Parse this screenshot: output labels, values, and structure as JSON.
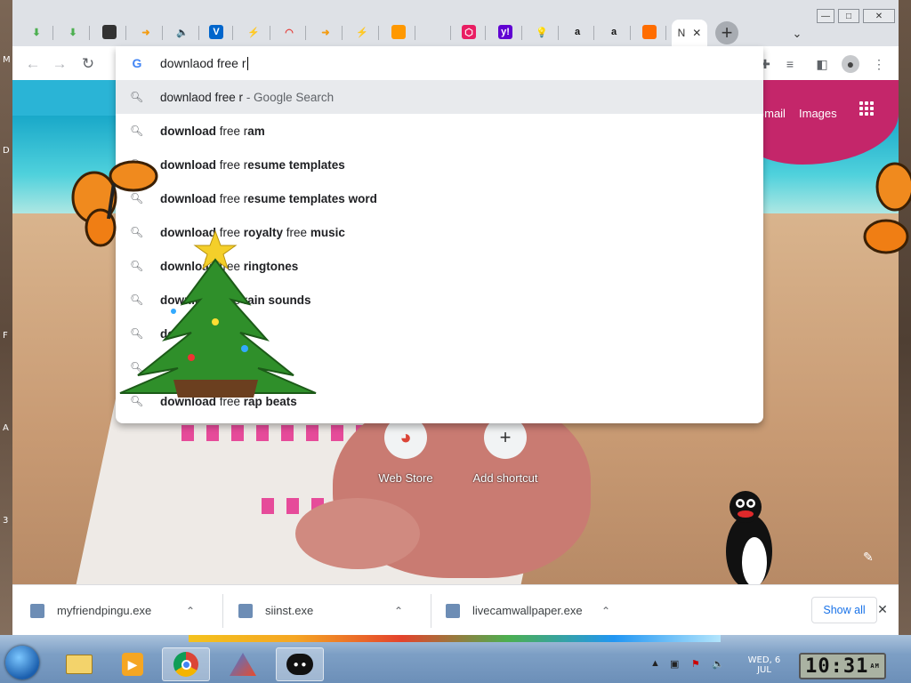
{
  "desktop": {
    "side_letters": [
      "M",
      "D",
      "F",
      "A",
      "3"
    ]
  },
  "tabs": [
    {
      "icon": "download-icon",
      "color": "#4caf50",
      "glyph": "⬇"
    },
    {
      "icon": "download-icon",
      "color": "#4caf50",
      "glyph": "⬇"
    },
    {
      "icon": "keyboard-icon",
      "color": "#333333",
      "glyph": "⌨"
    },
    {
      "icon": "arrow-icon",
      "color": "#f39c12",
      "glyph": "➜"
    },
    {
      "icon": "speaker-icon",
      "color": "#555555",
      "glyph": "🔈"
    },
    {
      "icon": "v-icon",
      "color": "#0066cc",
      "glyph": "V"
    },
    {
      "icon": "lightning-icon",
      "color": "#1e88e5",
      "glyph": "⚡"
    },
    {
      "icon": "arc-icon",
      "color": "#e53935",
      "glyph": "◠"
    },
    {
      "icon": "arrow-icon",
      "color": "#f39c12",
      "glyph": "➜"
    },
    {
      "icon": "lightning-icon",
      "color": "#1e88e5",
      "glyph": "⚡"
    },
    {
      "icon": "orange-circle-icon",
      "color": "#ff9800",
      "glyph": "●"
    },
    {
      "icon": "blank-icon",
      "color": "#dee1e6",
      "glyph": ""
    },
    {
      "icon": "shield-icon",
      "color": "#e91e63",
      "glyph": "⬡"
    },
    {
      "icon": "yahoo-icon",
      "color": "#6001d2",
      "glyph": "y!"
    },
    {
      "icon": "bulb-icon",
      "color": "#ffc107",
      "glyph": "💡"
    },
    {
      "icon": "amazon-icon",
      "color": "#111111",
      "glyph": "a"
    },
    {
      "icon": "amazon-icon",
      "color": "#111111",
      "glyph": "a"
    },
    {
      "icon": "firefox-icon",
      "color": "#ff6d00",
      "glyph": "●"
    }
  ],
  "active_tab": {
    "label": "N",
    "close": "✕"
  },
  "new_tab": {
    "glyph": "+"
  },
  "window_controls": {
    "minimize": "—",
    "maximize": "□",
    "close": "✕"
  },
  "omnibox": {
    "text": "downlaod free r",
    "suggestions": [
      {
        "bold_a": "",
        "plain": "downlaod free r",
        "bold_b": "",
        "suffix": " - Google Search"
      },
      {
        "bold_a": "download",
        "plain": " free r",
        "bold_b": "am",
        "suffix": ""
      },
      {
        "bold_a": "download",
        "plain": " free r",
        "bold_b": "esume templates",
        "suffix": ""
      },
      {
        "bold_a": "download",
        "plain": " free r",
        "bold_b": "esume templates word",
        "suffix": ""
      },
      {
        "bold_a": "download",
        "plain": " free ",
        "bold_b": "royalty",
        "plain2": " free ",
        "bold_c": "music"
      },
      {
        "bold_a": "download",
        "plain": " free ",
        "bold_b": "ringtones",
        "suffix": ""
      },
      {
        "bold_a": "download",
        "plain": " free r",
        "bold_b": "ain sounds",
        "suffix": ""
      },
      {
        "bold_a": "do",
        "plain": "",
        "bold_b": "",
        "suffix": ""
      },
      {
        "bold_a": "",
        "plain": "",
        "bold_b": "",
        "suffix": ""
      },
      {
        "bold_a": "download",
        "plain": " free ",
        "bold_b": "rap beats",
        "suffix": ""
      }
    ]
  },
  "ntp": {
    "gmail": "Gmail",
    "images": "Images",
    "shortcuts": [
      {
        "label": "Web Store",
        "glyph": "◕"
      },
      {
        "label": "Add shortcut",
        "glyph": "+"
      }
    ]
  },
  "downloads": [
    {
      "name": "myfriendpingu.exe",
      "chev": "⌃"
    },
    {
      "name": "siinst.exe",
      "chev": "⌃"
    },
    {
      "name": "livecamwallpaper.exe",
      "chev": "⌃"
    }
  ],
  "download_shelf": {
    "show_all": "Show all",
    "close": "✕"
  },
  "taskbar": {
    "date_line1": "WED, 6",
    "date_line2": "JUL",
    "time": "10:31",
    "time_suffix": "AM"
  }
}
